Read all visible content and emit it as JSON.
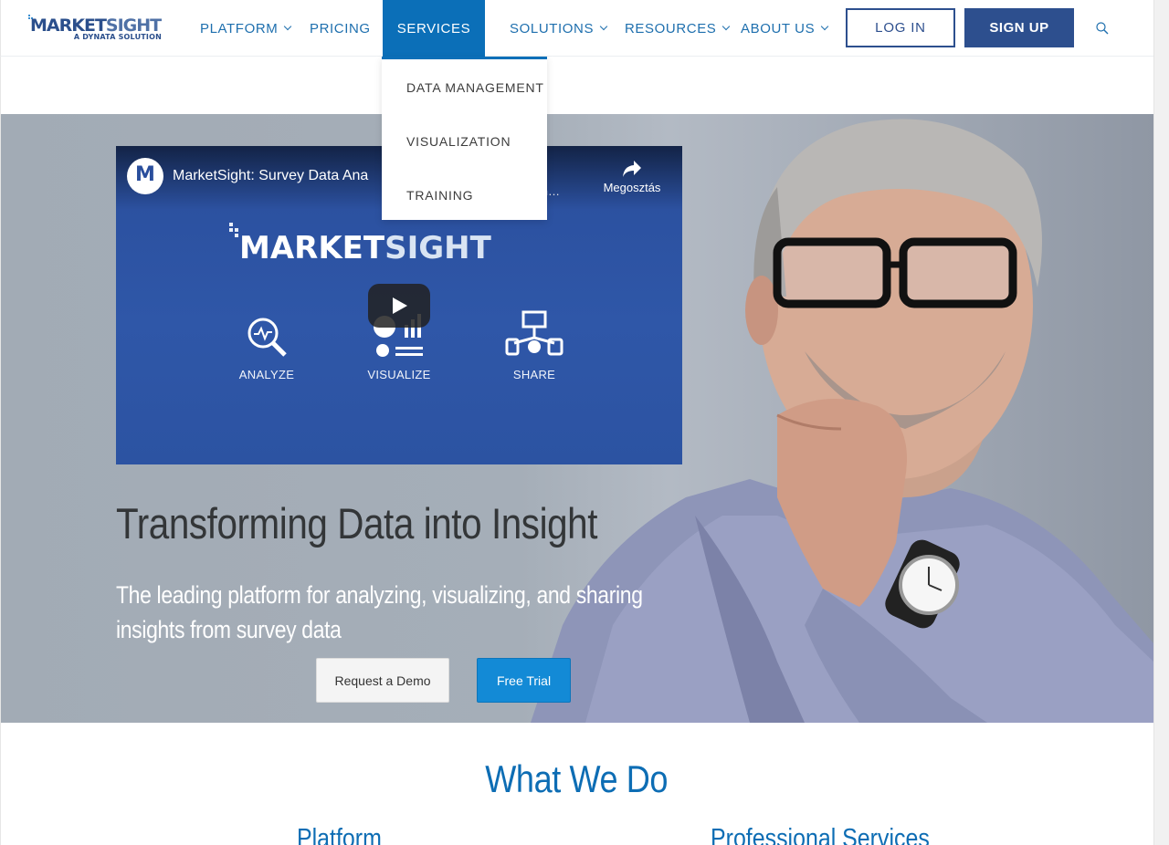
{
  "nav": {
    "logo_main_1": "MARKET",
    "logo_main_2": "SIGHT",
    "logo_sub": "A DYNATA SOLUTION",
    "items": [
      {
        "label": "PLATFORM"
      },
      {
        "label": "PRICING"
      },
      {
        "label": "SERVICES"
      },
      {
        "label": "SOLUTIONS"
      },
      {
        "label": "RESOURCES"
      },
      {
        "label": "ABOUT US"
      }
    ],
    "login": "LOG IN",
    "signup": "SIGN UP",
    "search_icon": "search-icon"
  },
  "dropdown": {
    "items": [
      "DATA MANAGEMENT",
      "VISUALIZATION",
      "TRAINING"
    ]
  },
  "video": {
    "channel_initial": "M",
    "title": "MarketSight: Survey Data Ana",
    "watch_later": "zen…",
    "share": "Megosztás",
    "logo_1": "MARKET",
    "logo_2": "SIGHT",
    "features": [
      "ANALYZE",
      "VISUALIZE",
      "SHARE"
    ]
  },
  "hero": {
    "title": "Transforming Data into Insight",
    "subtitle": "The leading platform for analyzing, visualizing, and sharing insights from survey data",
    "demo_button": "Request a Demo",
    "trial_button": "Free Trial"
  },
  "section": {
    "heading": "What We Do",
    "col1": "Platform",
    "col2": "Professional Services"
  },
  "colors": {
    "brand_blue": "#0b6fb8",
    "navy": "#2d4f8e",
    "trial_blue": "#138ad6"
  }
}
